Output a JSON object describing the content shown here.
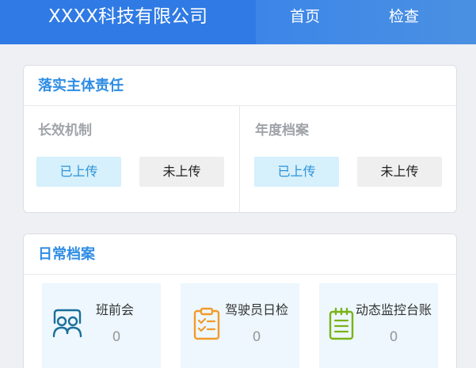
{
  "header": {
    "company": "XXXX科技有限公司",
    "nav": {
      "home": "首页",
      "check": "检查"
    }
  },
  "responsibility": {
    "title": "落实主体责任",
    "sections": [
      {
        "title": "长效机制",
        "uploaded": "已上传",
        "not_uploaded": "未上传"
      },
      {
        "title": "年度档案",
        "uploaded": "已上传",
        "not_uploaded": "未上传"
      }
    ]
  },
  "daily": {
    "title": "日常档案",
    "tiles": [
      {
        "label": "班前会",
        "count": "0",
        "icon": "meeting-people-icon",
        "color": "#1a6e9c"
      },
      {
        "label": "驾驶员日检",
        "count": "0",
        "icon": "clipboard-checklist-icon",
        "color": "#f39a2b"
      },
      {
        "label": "动态监控台账",
        "count": "0",
        "icon": "ledger-notebook-icon",
        "color": "#7ab317"
      }
    ]
  },
  "colors": {
    "header_blue": "#2f7ae4",
    "title_blue": "#2f8de4",
    "uploaded_bg": "#d6f0fc",
    "not_uploaded_bg": "#efefef"
  }
}
